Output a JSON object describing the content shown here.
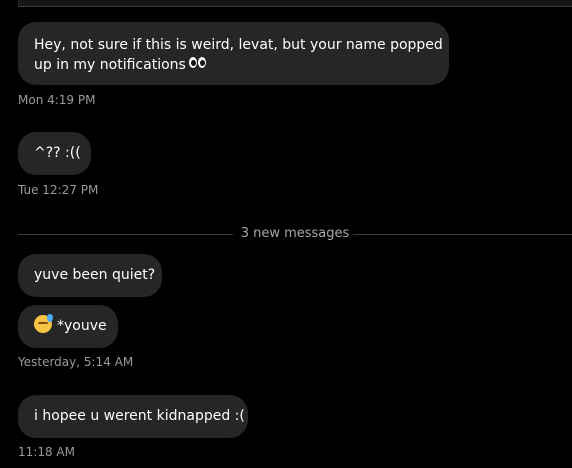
{
  "thread": {
    "messages": [
      {
        "text": "Hey, not sure if this is weird, levat, but your name popped",
        "text_line2": "up in my notifications",
        "emoji": "eyes-emoji"
      },
      {
        "text": "^?? :(("
      },
      {
        "text": "yuve been quiet?"
      },
      {
        "text": "*youve",
        "emoji": "sleepy-face-emoji"
      },
      {
        "text": "i hopee u werent kidnapped :("
      }
    ],
    "timestamps": [
      "Mon 4:19 PM",
      "Tue 12:27 PM",
      "Yesterday, 5:14 AM",
      "11:18 AM"
    ],
    "divider": {
      "label": "3 new messages"
    }
  },
  "colors": {
    "background": "#000000",
    "bubble": "#262626",
    "timestamp": "#9a9a9a",
    "divider_line": "#3c3c3c"
  }
}
